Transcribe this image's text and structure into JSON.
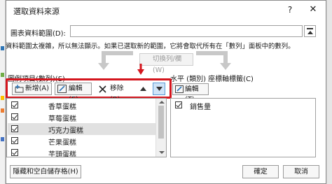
{
  "dialog": {
    "title": "選取資料來源",
    "help": "?",
    "close": "✕"
  },
  "range": {
    "label": "圖表資料範圍(D):",
    "value": ""
  },
  "notice": "資料範圍太複雜，所以無法顯示。如果已選取新的範圍，它將會取代所有在「數列」面板中的數列。",
  "switch_button": "切換列/欄(W)",
  "legend": {
    "label": "圖例項目(數列)(S)",
    "toolbar": {
      "add": "新增(A)",
      "edit": "編輯(E)",
      "remove": "移除(R)"
    },
    "items": [
      {
        "label": "香草蛋糕",
        "checked": true
      },
      {
        "label": "草莓蛋糕",
        "checked": true
      },
      {
        "label": "巧克力蛋糕",
        "checked": true
      },
      {
        "label": "芒果蛋糕",
        "checked": true
      },
      {
        "label": "芋頭蛋糕",
        "checked": true
      }
    ]
  },
  "axis": {
    "label": "水平 (類別) 座標軸標籤(C)",
    "edit": "編輯(T)",
    "items": [
      {
        "label": "銷售量",
        "checked": true
      }
    ]
  },
  "footer": {
    "hidden_cells": "隱藏和空白儲存格(H)",
    "ok": "確定",
    "cancel": "取消"
  },
  "colors": {
    "highlight": "#d4161e",
    "selected_row": "#e1e1e1",
    "active_button": "#cfe3f7"
  }
}
